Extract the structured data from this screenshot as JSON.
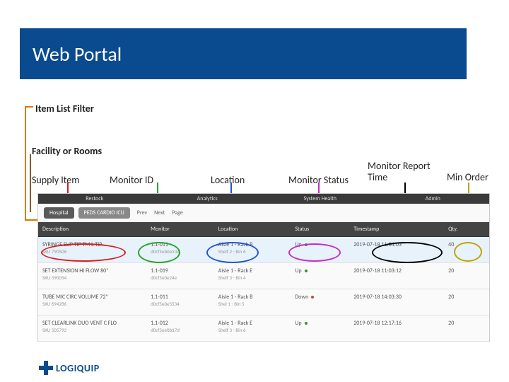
{
  "title": "Web Portal",
  "annotations": {
    "item_list_filter": "Item List Filter",
    "facility_or_rooms": "Facility or Rooms",
    "supply_item": "Supply Item",
    "monitor_id": "Monitor ID",
    "location": "Location",
    "monitor_status": "Monitor Status",
    "monitor_report_time": "Monitor Report Time",
    "min_order": "Min Order"
  },
  "panel": {
    "top_nav": [
      "Restock",
      "Analytics",
      "System Health",
      "Admin"
    ],
    "filters": {
      "facility": "Hospital",
      "room": "PEDS CARDIO ICU",
      "prev": "Prev",
      "next": "Next",
      "page": "Page"
    },
    "headers": [
      "Description",
      "Monitor",
      "Location",
      "Status",
      "Timestamp",
      "Qty."
    ],
    "rows": [
      {
        "desc": "SYRINGE SLIP TIP TM L TIP",
        "sku": "SKU 790506",
        "monitor": "1.1-011",
        "mac": "d0cf5eb0e534",
        "loc": "Aisle 1 - Rack B",
        "shelf": "Shelf 2 - Bin 6",
        "status": "Up",
        "ts": "2019-07-18 11:04:03",
        "qty": "40"
      },
      {
        "desc": "SET EXTENSION HI FLOW 80\"",
        "sku": "SKU 590054",
        "monitor": "1.1-019",
        "mac": "d0cf5e0e24e",
        "loc": "Aisle 1 - Rack E",
        "shelf": "Shelf 3 - Bin 4",
        "status": "Up",
        "ts": "2019-07-18 11:03:12",
        "qty": "20"
      },
      {
        "desc": "TUBE MIC CIRC VOLUME 72\"",
        "sku": "SKU 694286",
        "monitor": "1.1-011",
        "mac": "d0cf5e0e5534",
        "loc": "Aisle 1 - Rack B",
        "shelf": "Shel 1 - Bin 5",
        "status": "Down",
        "ts": "2019-07-18 14:03:30",
        "qty": "20"
      },
      {
        "desc": "SET CLEARLINK DUO VENT C FLO",
        "sku": "SKU 505792",
        "monitor": "1.1-012",
        "mac": "d0cf5ee0b17d",
        "loc": "Aisle 1 - Rack E",
        "shelf": "Shelf 3 - Bin 6",
        "status": "Up",
        "ts": "2019-07-18 12:17:16",
        "qty": "20"
      }
    ]
  },
  "logo": "LOGIQUIP"
}
